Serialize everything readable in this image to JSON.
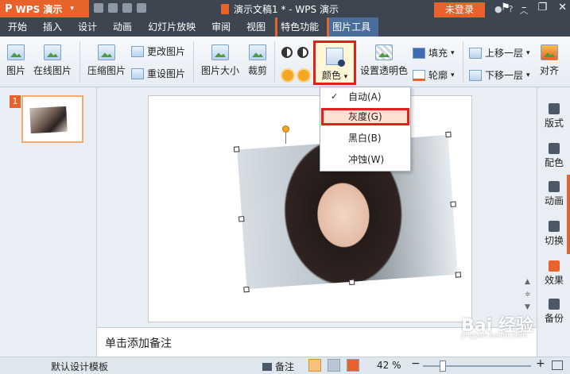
{
  "app": {
    "name": "WPS 演示",
    "logo": "P"
  },
  "window": {
    "title": "演示文稿1 * - WPS 演示"
  },
  "menu": {
    "tabs": [
      "开始",
      "插入",
      "设计",
      "动画",
      "幻灯片放映",
      "审阅",
      "视图"
    ],
    "special_tab": "特色功能",
    "active_tab": "图片工具",
    "login": "未登录"
  },
  "ribbon": {
    "picture": "图片",
    "online_picture": "在线图片",
    "compress": "压缩图片",
    "change_picture": "更改图片",
    "reset_picture": "重设图片",
    "picture_size": "图片大小",
    "crop": "裁剪",
    "color": "颜色",
    "set_transparent": "设置透明色",
    "fill": "填充",
    "outline": "轮廓",
    "bring_forward": "上移一层",
    "send_backward": "下移一层",
    "align": "对齐"
  },
  "color_menu": {
    "items": [
      "自动(A)",
      "灰度(G)",
      "黑白(B)",
      "冲蚀(W)"
    ],
    "checked": "自动(A)",
    "highlighted": "灰度(G)"
  },
  "thumbnails": {
    "slide_number": "1"
  },
  "right_panel": {
    "items": [
      "版式",
      "配色",
      "动画",
      "切换",
      "效果",
      "备份"
    ]
  },
  "notes": {
    "placeholder": "单击添加备注"
  },
  "status": {
    "template": "默认设计模板",
    "notes_label": "备注",
    "zoom": "42 %",
    "zoom_level": 0.42
  },
  "watermark": {
    "text": "Bai 经验",
    "sub": "jingyan.baidu.com"
  },
  "colors": {
    "accent": "#e8622c",
    "highlight_border": "#e0201c",
    "titlebar": "#3c4550"
  },
  "icons": {
    "picture": "picture-icon",
    "color": "color-icon",
    "transparent": "transparent-icon",
    "fill": "fill-icon",
    "outline": "outline-icon",
    "check": "check-icon"
  }
}
